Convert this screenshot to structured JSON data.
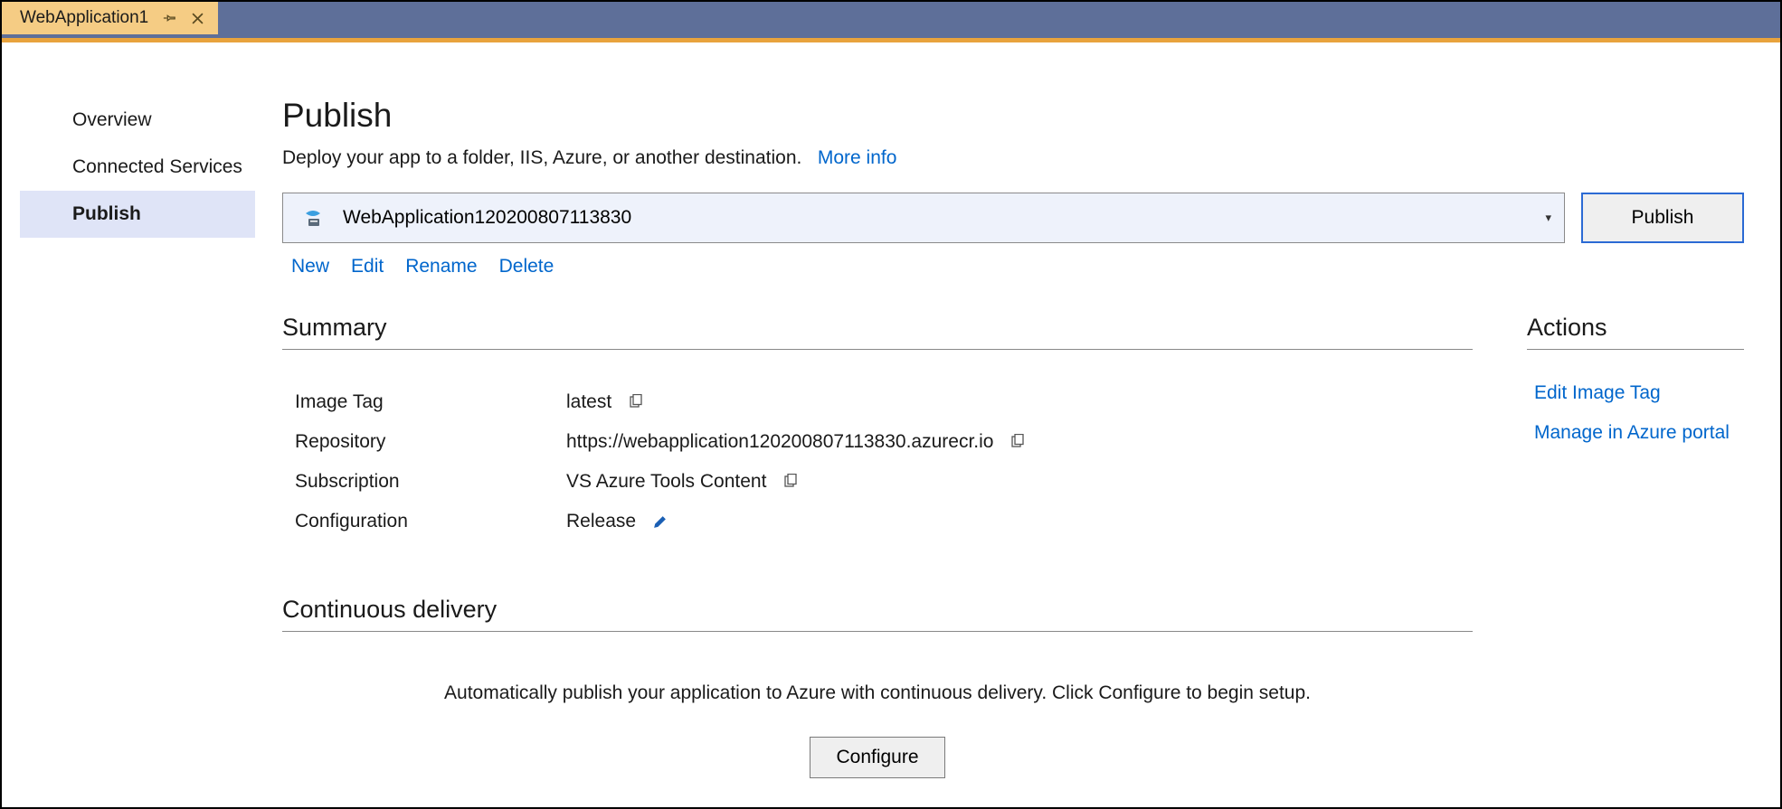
{
  "tab": {
    "title": "WebApplication1"
  },
  "sidebar": {
    "items": [
      {
        "label": "Overview"
      },
      {
        "label": "Connected Services"
      },
      {
        "label": "Publish"
      }
    ]
  },
  "header": {
    "title": "Publish",
    "subtitle": "Deploy your app to a folder, IIS, Azure, or another destination.",
    "more_info": "More info"
  },
  "profile": {
    "selected": "WebApplication120200807113830",
    "publish_button": "Publish",
    "actions": {
      "new": "New",
      "edit": "Edit",
      "rename": "Rename",
      "delete": "Delete"
    }
  },
  "summary": {
    "heading": "Summary",
    "rows": {
      "image_tag": {
        "label": "Image Tag",
        "value": "latest"
      },
      "repository": {
        "label": "Repository",
        "value": "https://webapplication120200807113830.azurecr.io"
      },
      "subscription": {
        "label": "Subscription",
        "value": "VS Azure Tools Content"
      },
      "configuration": {
        "label": "Configuration",
        "value": "Release"
      }
    }
  },
  "actions_panel": {
    "heading": "Actions",
    "items": {
      "edit_image_tag": "Edit Image Tag",
      "manage_portal": "Manage in Azure portal"
    }
  },
  "continuous_delivery": {
    "heading": "Continuous delivery",
    "text": "Automatically publish your application to Azure with continuous delivery. Click Configure to begin setup.",
    "button": "Configure"
  }
}
